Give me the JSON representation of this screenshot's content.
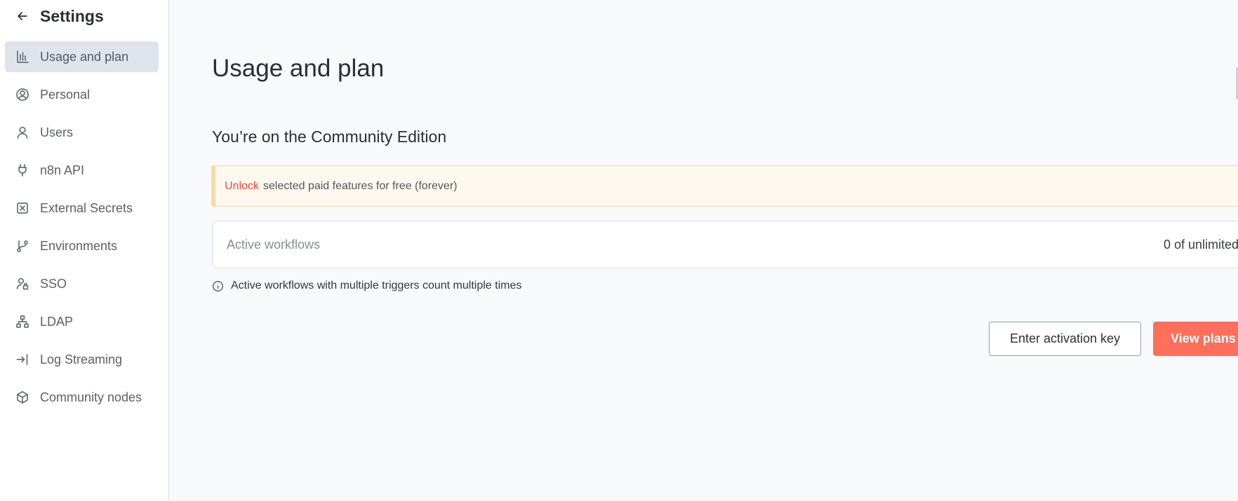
{
  "sidebar": {
    "title": "Settings",
    "items": [
      {
        "label": "Usage and plan",
        "icon": "chart-bar-icon",
        "active": true
      },
      {
        "label": "Personal",
        "icon": "user-circle-icon"
      },
      {
        "label": "Users",
        "icon": "user-icon"
      },
      {
        "label": "n8n API",
        "icon": "plug-icon"
      },
      {
        "label": "External Secrets",
        "icon": "vault-icon"
      },
      {
        "label": "Environments",
        "icon": "git-branch-icon"
      },
      {
        "label": "SSO",
        "icon": "user-lock-icon"
      },
      {
        "label": "LDAP",
        "icon": "network-icon"
      },
      {
        "label": "Log Streaming",
        "icon": "sign-in-icon"
      },
      {
        "label": "Community nodes",
        "icon": "cube-icon"
      }
    ]
  },
  "main": {
    "title": "Usage and plan",
    "edition": "You’re on the Community Edition",
    "callout": {
      "link": "Unlock",
      "text": "selected paid features for free (forever)"
    },
    "usage": {
      "label": "Active workflows",
      "value": "0 of unlimited"
    },
    "info": "Active workflows with multiple triggers count multiple times",
    "buttons": {
      "activation": "Enter activation key",
      "plans": "View plans"
    }
  },
  "colors": {
    "accent": "#ff6f5c",
    "callout_bg": "#fef8ee",
    "callout_border": "#f6d9a6",
    "active_nav": "#dfe3eb"
  }
}
